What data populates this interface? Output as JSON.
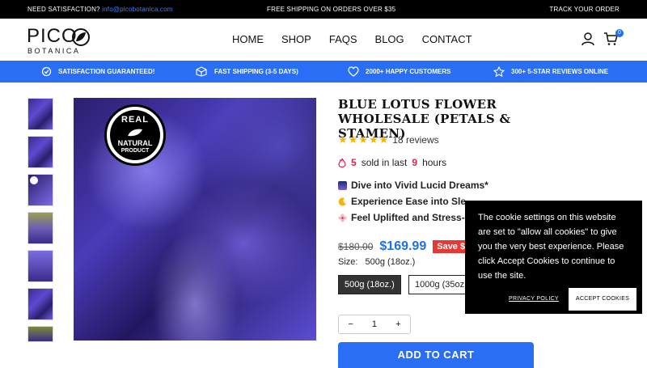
{
  "topbar": {
    "need_label": "NEED SATISFACTION?",
    "email": "info@picobotanica.com",
    "shipping": "FREE SHIPPING ON ORDERS OVER $35",
    "track": "TRACK YOUR ORDER"
  },
  "logo": {
    "brand": "PICO",
    "sub": "BOTANICA"
  },
  "nav": [
    "HOME",
    "SHOP",
    "FAQS",
    "BLOG",
    "CONTACT"
  ],
  "cart": {
    "count": "0"
  },
  "benefits": [
    "SATISFACTION GUARANTEED!",
    "FAST SHIPPING (3-5 DAYS)",
    "2000+ HAPPY CUSTOMERS",
    "300+ 5-STAR REVIEWS ONLINE"
  ],
  "seal": {
    "line1": "REAL",
    "line2": "NATURAL",
    "line3": "PRODUCT"
  },
  "product": {
    "title": "BLUE LOTUS FLOWER WHOLESALE (PETALS & STAMEN)",
    "stars": "★★★★★",
    "reviews": "18 reviews",
    "sold_count": "5",
    "sold_text": "sold in last",
    "sold_hours": "9",
    "hours_label": "hours",
    "features": [
      "Dive into Vivid Lucid Dreams*",
      "Experience Ease into Sle",
      "Feel Uplifted and Stress-"
    ],
    "old_price": "$180.00",
    "new_price": "$169.99",
    "save": "Save $",
    "size_label": "Size:",
    "size_value": "500g (18oz.)",
    "options": [
      "500g (18oz.)",
      "1000g (35oz"
    ],
    "quantity": "1",
    "add_to_cart": "ADD TO CART"
  },
  "cookie": {
    "message": "The cookie settings on this website are set to \"allow all cookies\" to give you the very best experience. Please click Accept Cookies to continue to use the site.",
    "privacy": "PRIVACY POLICY",
    "accept": "ACCEPT COOKIES"
  },
  "colors": {
    "accent": "#2a6ef5",
    "sale": "#e53935",
    "star": "#f5b400"
  }
}
